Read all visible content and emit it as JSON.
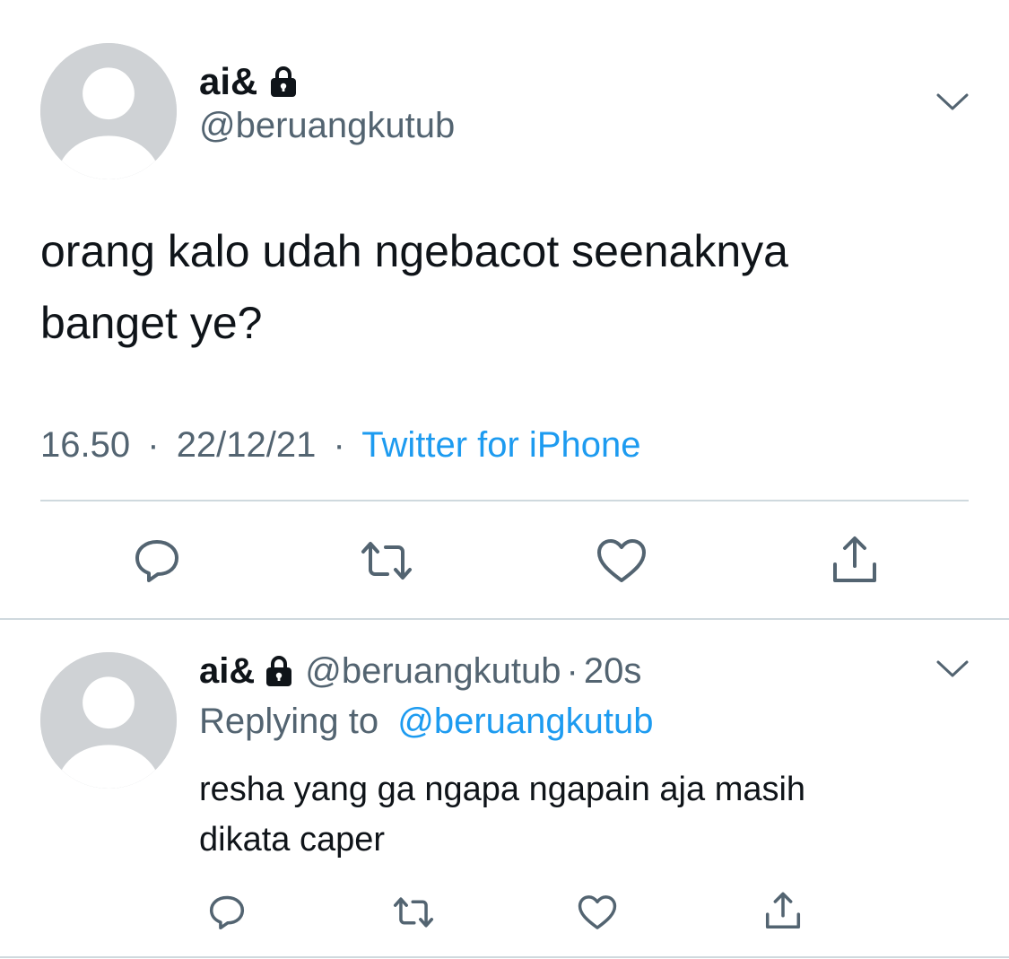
{
  "main_tweet": {
    "display_name": "ai&",
    "handle": "@beruangkutub",
    "text_line1": "orang kalo udah ngebacot seenaknya",
    "text_line2": "banget ye?",
    "time": "16.50",
    "separator": "·",
    "date": "22/12/21",
    "source": "Twitter for iPhone"
  },
  "reply_tweet": {
    "display_name": "ai&",
    "handle": "@beruangkutub",
    "separator": "·",
    "age": "20s",
    "replying_to_prefix": "Replying to",
    "replying_to_handle": "@beruangkutub",
    "text_line1": "resha yang ga ngapa ngapain aja masih",
    "text_line2": "dikata caper"
  },
  "icons": {
    "lock": "lock-icon",
    "chevron": "chevron-down-icon",
    "reply": "reply-icon",
    "retweet": "retweet-icon",
    "like": "heart-icon",
    "share": "share-icon"
  },
  "colors": {
    "text": "#0f1419",
    "muted": "#536471",
    "link": "#1d9bf0",
    "avatar": "#cfd2d5",
    "divider": "#cfd9de"
  }
}
